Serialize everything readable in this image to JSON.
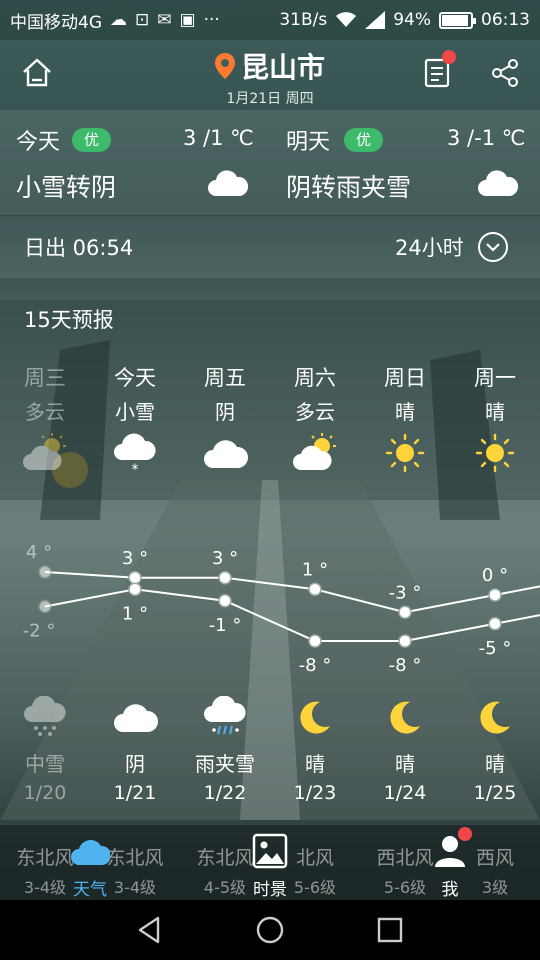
{
  "status_bar": {
    "carrier": "中国移动4G",
    "speed": "31B/s",
    "battery": "94%",
    "battery_level": 0.94,
    "time": "06:13",
    "net_type": "4G"
  },
  "header": {
    "city": "昆山市",
    "date": "1月21日 周四"
  },
  "today": {
    "label": "今天",
    "aqi": "优",
    "temp": "3 /1 ℃",
    "condition": "小雪转阴"
  },
  "tomorrow": {
    "label": "明天",
    "aqi": "优",
    "temp": "3 /-1 ℃",
    "condition": "阴转雨夹雪"
  },
  "sun": {
    "sunrise": "日出 06:54",
    "hours_label": "24小时"
  },
  "forecast_title": "15天预报",
  "days": [
    {
      "weekday": "周三",
      "day_cond": "多云",
      "day_icon": "partly-cloudy-icon",
      "high": "4 °",
      "low": "-2 °",
      "night_icon": "snow-cloud-icon",
      "night_cond": "中雪",
      "date": "1/20",
      "wind_dir": "东北风",
      "wind_level": "3-4级"
    },
    {
      "weekday": "今天",
      "day_cond": "小雪",
      "day_icon": "light-snow-icon",
      "high": "3 °",
      "low": "1 °",
      "night_icon": "cloud-icon",
      "night_cond": "阴",
      "date": "1/21",
      "wind_dir": "东北风",
      "wind_level": "3-4级"
    },
    {
      "weekday": "周五",
      "day_cond": "阴",
      "day_icon": "cloud-icon",
      "high": "3 °",
      "low": "-1 °",
      "night_icon": "sleet-icon",
      "night_cond": "雨夹雪",
      "date": "1/22",
      "wind_dir": "东北风",
      "wind_level": "4-5级"
    },
    {
      "weekday": "周六",
      "day_cond": "多云",
      "day_icon": "partly-cloudy-icon",
      "high": "1 °",
      "low": "-8 °",
      "night_icon": "moon-icon",
      "night_cond": "晴",
      "date": "1/23",
      "wind_dir": "北风",
      "wind_level": "5-6级"
    },
    {
      "weekday": "周日",
      "day_cond": "晴",
      "day_icon": "sun-icon",
      "high": "-3 °",
      "low": "-8 °",
      "night_icon": "moon-icon",
      "night_cond": "晴",
      "date": "1/24",
      "wind_dir": "西北风",
      "wind_level": "5-6级"
    },
    {
      "weekday": "周一",
      "day_cond": "晴",
      "day_icon": "sun-icon",
      "high": "0 °",
      "low": "-5 °",
      "night_icon": "moon-icon",
      "night_cond": "晴",
      "date": "1/25",
      "wind_dir": "西风",
      "wind_level": "3级"
    }
  ],
  "chart_data": {
    "type": "line",
    "categories": [
      "1/20",
      "1/21",
      "1/22",
      "1/23",
      "1/24",
      "1/25"
    ],
    "series": [
      {
        "values": [
          4,
          3,
          3,
          1,
          -3,
          0
        ]
      },
      {
        "values": [
          -2,
          1,
          -1,
          -8,
          -8,
          -5
        ]
      }
    ]
  },
  "tabs": [
    {
      "label": "天气",
      "active": true
    },
    {
      "label": "时景",
      "active": false
    },
    {
      "label": "我",
      "active": false
    }
  ],
  "colors": {
    "aqi_good": "#3dbb6a",
    "accent_blue": "#4fb3f0",
    "sun": "#ffd43b",
    "badge_red": "#f04848"
  }
}
